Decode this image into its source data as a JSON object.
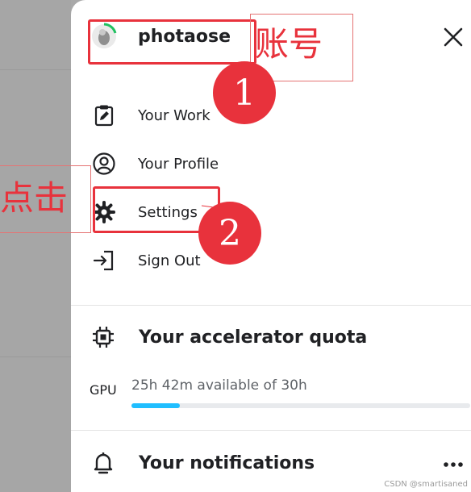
{
  "profile": {
    "username": "photaose"
  },
  "menu": {
    "items": [
      {
        "label": "Your Work",
        "icon": "clipboard-edit-icon"
      },
      {
        "label": "Your Profile",
        "icon": "user-circle-icon"
      },
      {
        "label": "Settings",
        "icon": "gear-icon"
      },
      {
        "label": "Sign Out",
        "icon": "sign-out-icon"
      }
    ]
  },
  "quota": {
    "title": "Your accelerator quota",
    "gpu_label": "GPU",
    "gpu_text": "25h 42m available of 30h",
    "gpu_used_fraction": 0.143
  },
  "notifications": {
    "title": "Your notifications"
  },
  "annotations": {
    "account_label": "账号",
    "click_label": "点击",
    "step1": "1",
    "step2": "2"
  },
  "watermark": "CSDN @smartisaned",
  "colors": {
    "accent": "#20beff",
    "annotation_red": "#e8323c",
    "avatar_ring": "#20c060"
  }
}
